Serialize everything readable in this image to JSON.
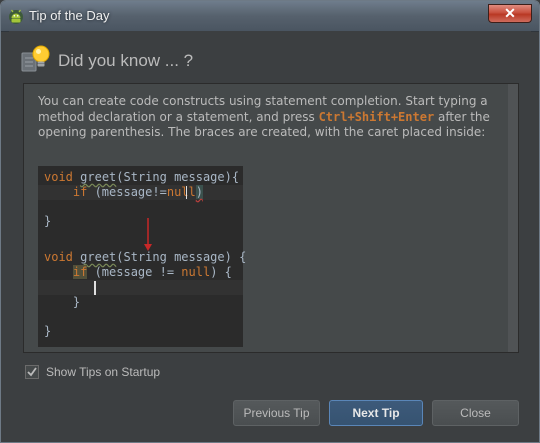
{
  "window": {
    "title": "Tip of the Day",
    "close_symbol": "✕",
    "app_icon": "android-icon"
  },
  "header": {
    "icon": "lightbulb-icon",
    "text": "Did you know ... ?"
  },
  "tip": {
    "text_before": "You can create code constructs using statement completion. Start typing a method declaration or a statement, and press ",
    "shortcut": "Ctrl+Shift+Enter",
    "text_after": " after the opening parenthesis. The braces are created, with the caret placed inside:"
  },
  "code_sample": {
    "before": {
      "line1_kw": "void",
      "line1_fn": "greet",
      "line1_rest": "(String message){",
      "line2_kw": "if",
      "line2_rest": " (message!=",
      "line2_null": "null",
      "line2_paren": ")",
      "line3": "}"
    },
    "after": {
      "line1_kw": "void",
      "line1_fn": "greet",
      "line1_rest": "(String message) {",
      "line2_kw": "if",
      "line2_rest": " (message != ",
      "line2_null": "null",
      "line2_end": ") {",
      "line4": "}",
      "line5": "}"
    }
  },
  "startup": {
    "label": "Show Tips on Startup",
    "checked": true
  },
  "buttons": {
    "previous": "Previous Tip",
    "next": "Next Tip",
    "close": "Close"
  },
  "colors": {
    "background": "#3c3f41",
    "keyword": "#cc7832",
    "accent_button": "#365371"
  }
}
